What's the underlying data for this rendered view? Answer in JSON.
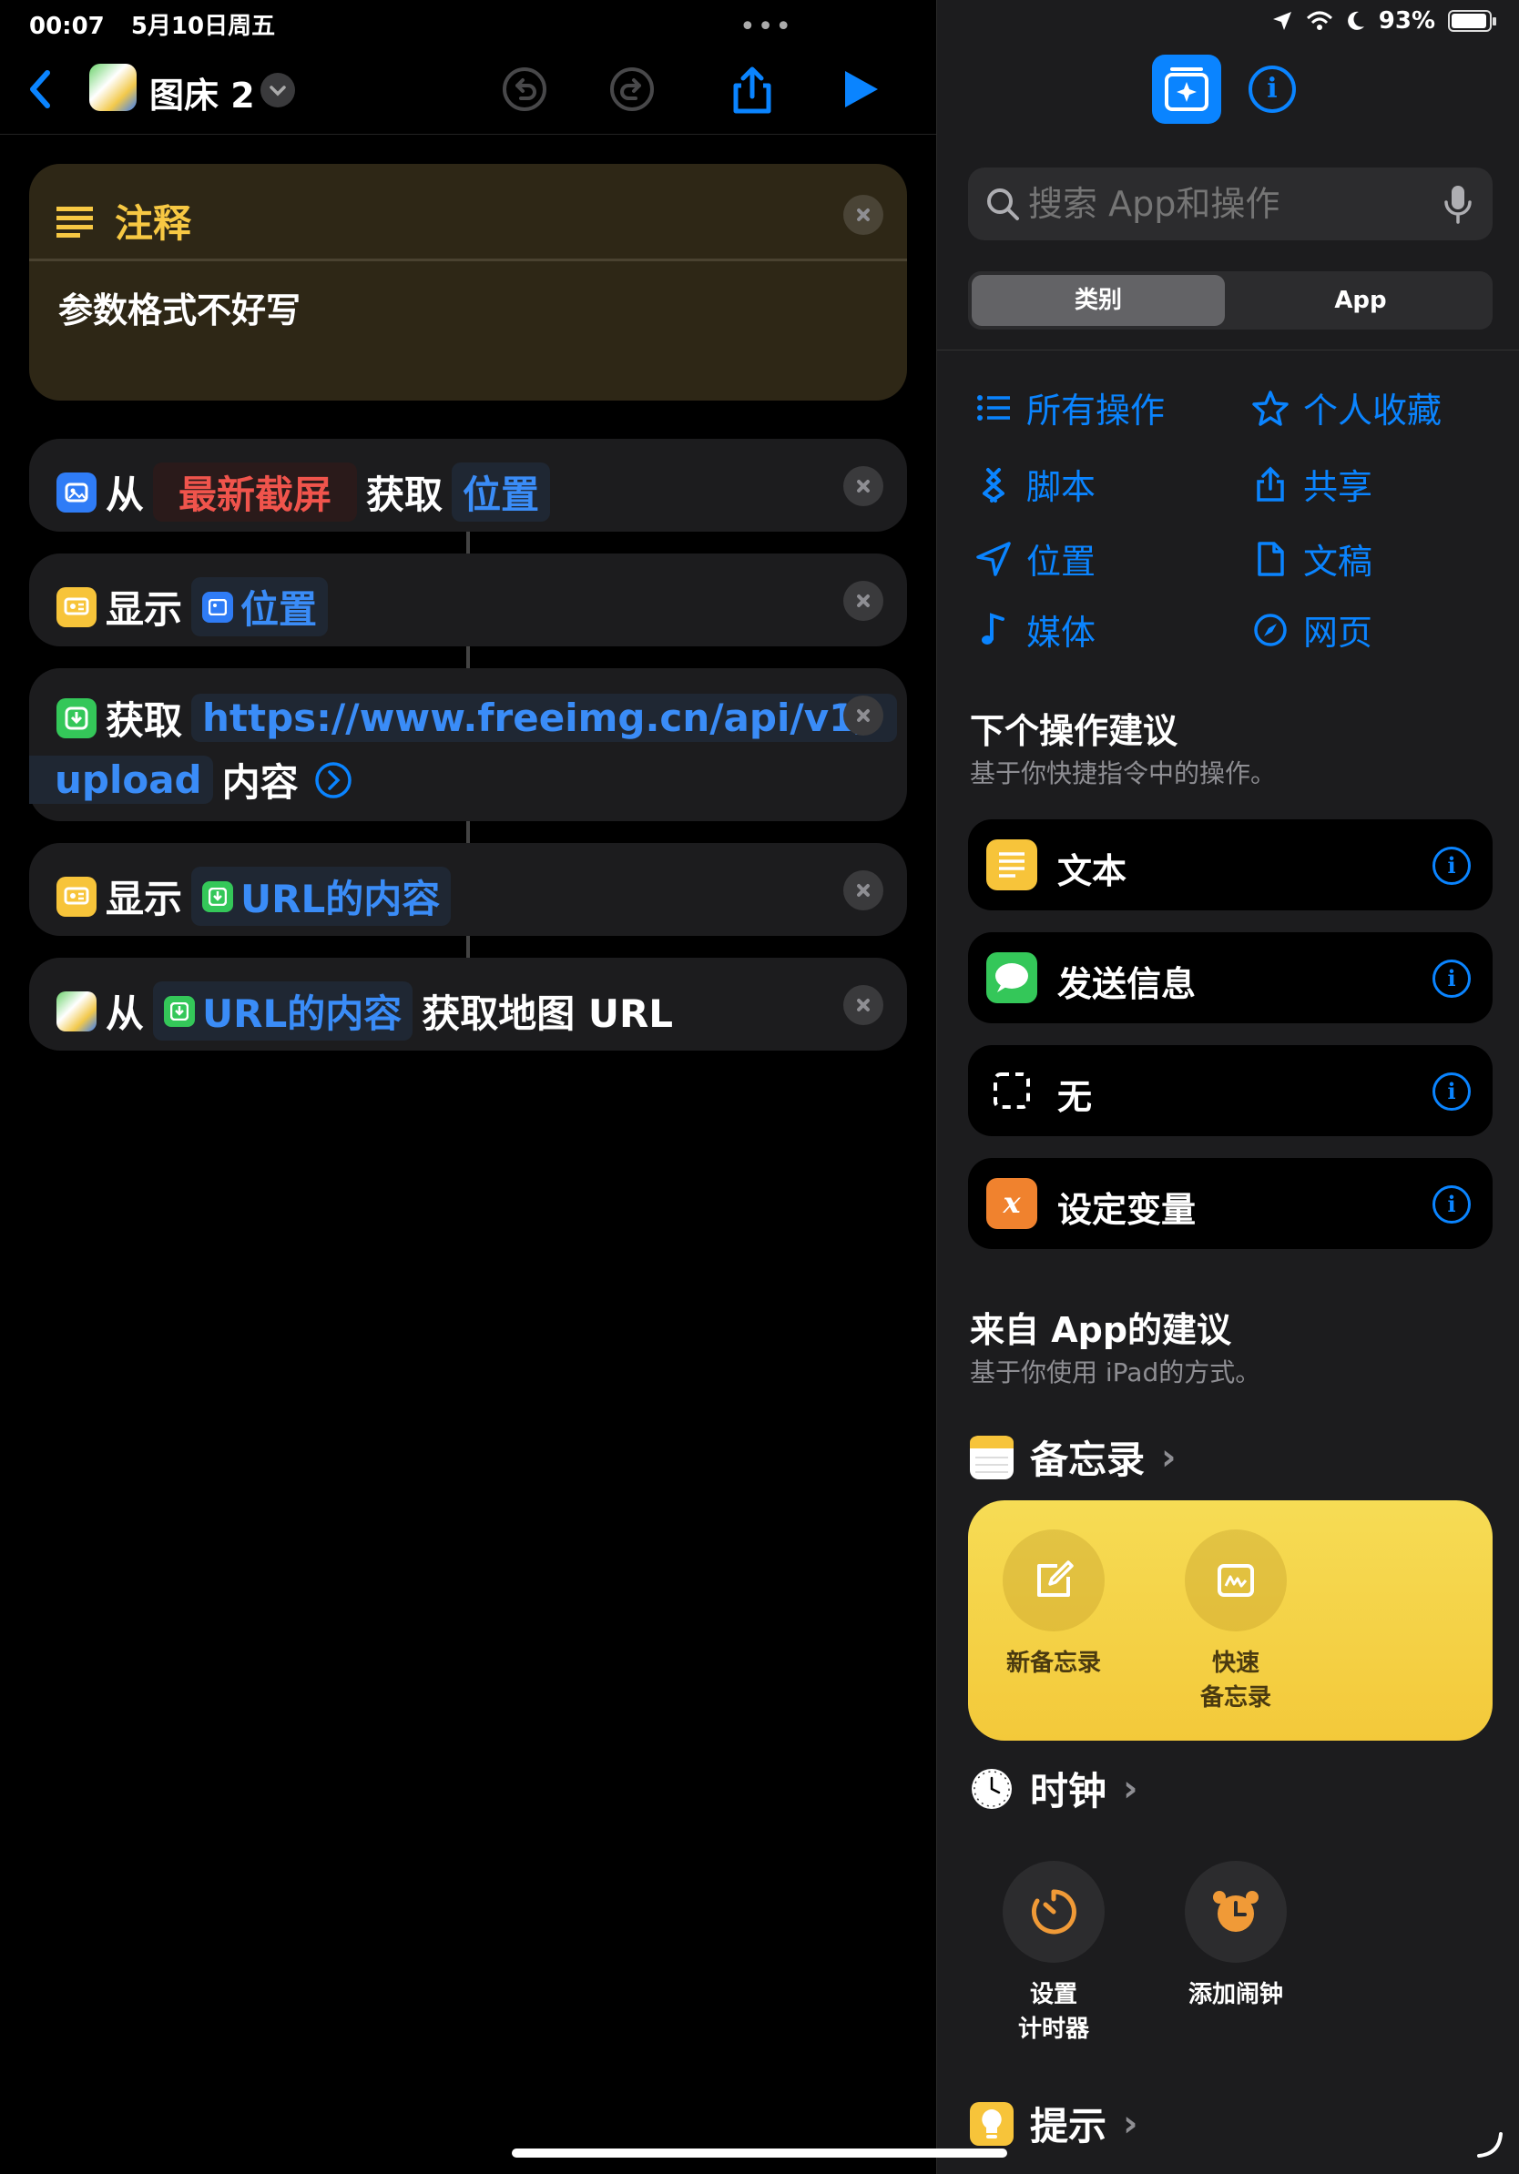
{
  "status": {
    "time": "00:07",
    "date": "5月10日周五",
    "battery": "93%"
  },
  "editor": {
    "title": "图床 2",
    "comment": {
      "header": "注释",
      "body": "参数格式不好写"
    },
    "actions": [
      {
        "verb": "从",
        "param1": "最新截屏",
        "verb2": "获取",
        "param2": "位置"
      },
      {
        "verb": "显示",
        "param": "位置"
      },
      {
        "verb": "获取",
        "url_line1": "https://www.freeimg.cn/api/v1/",
        "url_line2": "upload",
        "suffix": "内容"
      },
      {
        "verb": "显示",
        "param": "URL的内容"
      },
      {
        "verb": "从",
        "param": "URL的内容",
        "suffix": "获取地图 URL"
      }
    ]
  },
  "panel": {
    "search_placeholder": "搜索 App和操作",
    "segments": [
      "类别",
      "App"
    ],
    "categories": [
      "所有操作",
      "个人收藏",
      "脚本",
      "共享",
      "位置",
      "文稿",
      "媒体",
      "网页"
    ],
    "next_title": "下个操作建议",
    "next_sub": "基于你快捷指令中的操作。",
    "suggestions": [
      {
        "label": "文本",
        "color": "#f7c43a"
      },
      {
        "label": "发送信息",
        "color": "#34c759"
      },
      {
        "label": "无",
        "color": "#000000"
      },
      {
        "label": "设定变量",
        "color": "#f0822e"
      }
    ],
    "app_title": "来自 App的建议",
    "app_sub": "基于你使用 iPad的方式。",
    "apps": {
      "notes": {
        "name": "备忘录",
        "actions": [
          "新备忘录",
          "快速\n备忘录"
        ]
      },
      "clock": {
        "name": "时钟",
        "actions": [
          "设置\n计时器",
          "添加闹钟"
        ]
      },
      "reminders": {
        "name": "提示"
      }
    }
  }
}
